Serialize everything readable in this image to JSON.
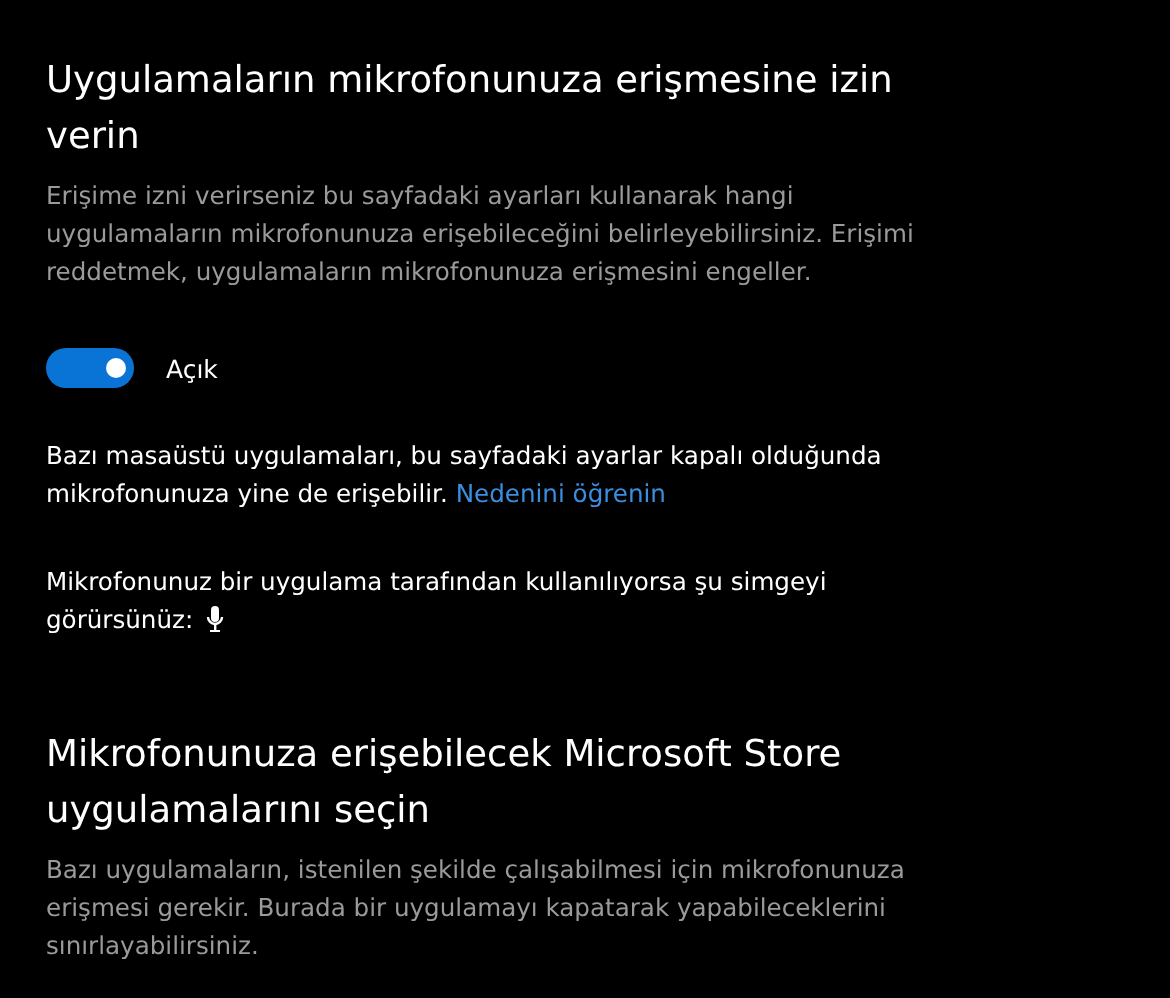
{
  "sections": [
    {
      "title": "Uygulamaların mikrofonunuza erişmesine izin verin",
      "description": "Erişime izni verirseniz bu sayfadaki ayarları kullanarak hangi uygulamaların mikrofonunuza erişebileceğini belirleyebilirsiniz. Erişimi reddetmek, uygulamaların mikrofonunuza erişmesini engeller.",
      "toggle": {
        "on": true,
        "label": "Açık"
      },
      "notes": [
        {
          "kind": "link",
          "text": "Bazı masaüstü uygulamaları, bu sayfadaki ayarlar kapalı olduğunda mikrofonunuza yine de erişebilir.",
          "link": "Nedenini öğrenin"
        },
        {
          "kind": "icon",
          "text": "Mikrofonunuz bir uygulama tarafından kullanılıyorsa şu simgeyi",
          "text_before_icon": "görürsünüz:"
        }
      ]
    },
    {
      "title": "Mikrofonunuza erişebilecek Microsoft Store uygulamalarını seçin",
      "description": "Bazı uygulamaların, istenilen şekilde çalışabilmesi için mikrofonunuza erişmesi gerekir. Burada bir uygulamayı kapatarak yapabileceklerini sınırlayabilirsiniz."
    }
  ]
}
